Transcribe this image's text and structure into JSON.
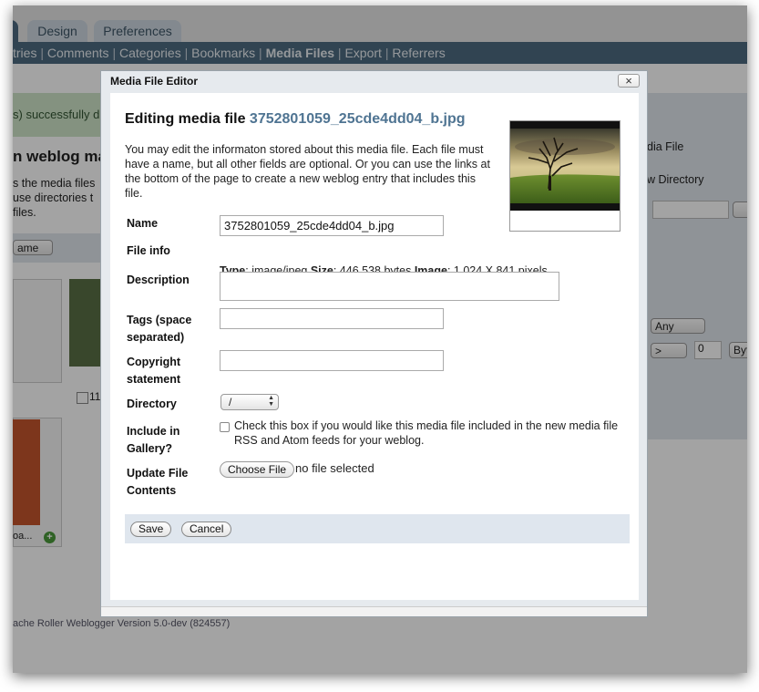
{
  "top_tabs": [
    "Design",
    "Preferences"
  ],
  "nav": {
    "items": [
      {
        "label": "tries",
        "active": false
      },
      {
        "label": "Comments",
        "active": false
      },
      {
        "label": "Categories",
        "active": false
      },
      {
        "label": "Bookmarks",
        "active": false
      },
      {
        "label": "Media Files",
        "active": true
      },
      {
        "label": "Export",
        "active": false
      },
      {
        "label": "Referrers",
        "active": false
      }
    ],
    "separator": "|"
  },
  "background": {
    "success_banner": "s) successfully d",
    "page_heading": "n weblog ma",
    "desc_lines": [
      "s the media files",
      "use directories t",
      " files."
    ],
    "right_links": [
      "dia File",
      "w Directory"
    ],
    "sort_select": "ame",
    "filter_select_any": "Any",
    "filter_select_op": ">",
    "filter_size_value": "0",
    "filter_unit": "Byt",
    "item_checkbox_label": "11",
    "item_caption": "oa...",
    "footer": "ache Roller Weblogger Version 5.0-dev (824557)"
  },
  "dialog": {
    "title": "Media File Editor",
    "close_label": "×",
    "heading_prefix": "Editing media file",
    "heading_filename": "3752801059_25cde4dd04_b.jpg",
    "intro": "You may edit the informaton stored about this media file. Each file must have a name, but all other fields are optional. Or you can use the links at the bottom of the page to create a new weblog entry that includes this file.",
    "labels": {
      "name": "Name",
      "file_info": "File info",
      "description": "Description",
      "tags": "Tags (space separated)",
      "copyright": "Copyright statement",
      "directory": "Directory",
      "gallery": "Include in Gallery?",
      "update": "Update File Contents"
    },
    "name_value": "3752801059_25cde4dd04_b.jpg",
    "file_info": {
      "type_label": "Type",
      "type_value": ": image/jpeg",
      "size_label": "Size",
      "size_value": ": 446,538 bytes",
      "image_label": "Image",
      "image_value": ": 1,024 X 841 pixels"
    },
    "description_value": "",
    "tags_value": "",
    "copyright_value": "",
    "directory_value": "/",
    "gallery_checked": false,
    "gallery_text": "Check this box if you would like this media file included in the new media file RSS and Atom feeds for your weblog.",
    "choose_file_label": "Choose File",
    "no_file_text": "no file selected",
    "save_label": "Save",
    "cancel_label": "Cancel"
  },
  "colors": {
    "nav_bg": "#4e6b80",
    "link_blue": "#4f7492",
    "footer_bar": "#dfe6ee",
    "banner_green": "#cfe5c9"
  }
}
